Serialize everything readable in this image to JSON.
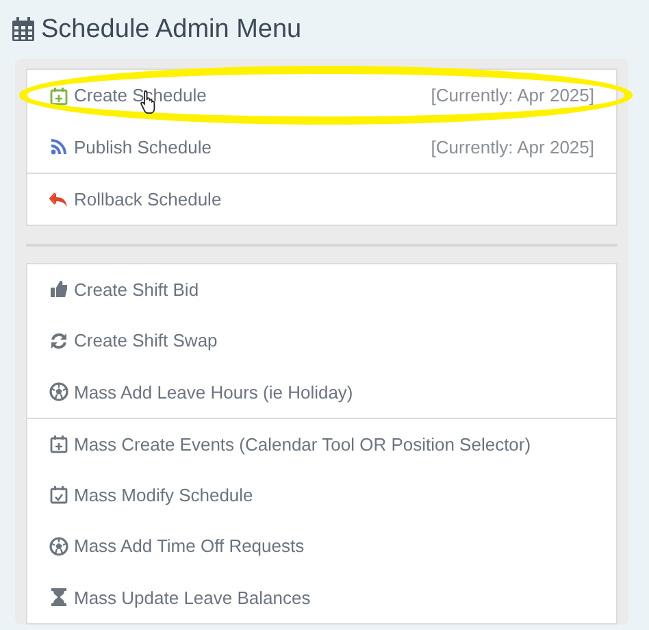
{
  "title": "Schedule Admin Menu",
  "groups": [
    {
      "items": [
        {
          "label": "Create Schedule",
          "note": "[Currently: Apr 2025]",
          "kind": "calendar-plus",
          "color": "#7cb342",
          "highlighted": true,
          "separated": false
        },
        {
          "label": "Publish Schedule",
          "note": "[Currently: Apr 2025]",
          "kind": "rss",
          "color": "#5577cc",
          "highlighted": false,
          "separated": false
        },
        {
          "label": "Rollback Schedule",
          "kind": "reply-all",
          "color": "#e0452b",
          "highlighted": false,
          "separated": true
        }
      ]
    },
    {
      "items": [
        {
          "label": "Create Shift Bid",
          "kind": "thumbs-up",
          "color": "#6c757d",
          "highlighted": false,
          "separated": false
        },
        {
          "label": "Create Shift Swap",
          "kind": "refresh",
          "color": "#6c757d",
          "highlighted": false,
          "separated": false
        },
        {
          "label": "Mass Add Leave Hours (ie Holiday)",
          "kind": "ball",
          "color": "#6c757d",
          "highlighted": false,
          "separated": false
        },
        {
          "label": "Mass Create Events (Calendar Tool OR Position Selector)",
          "kind": "calendar-plus",
          "color": "#6c757d",
          "highlighted": false,
          "separated": true
        },
        {
          "label": "Mass Modify Schedule",
          "kind": "calendar-check",
          "color": "#6c757d",
          "highlighted": false,
          "separated": false
        },
        {
          "label": "Mass Add Time Off Requests",
          "kind": "ball",
          "color": "#6c757d",
          "highlighted": false,
          "separated": false
        },
        {
          "label": "Mass Update Leave Balances",
          "kind": "hourglass",
          "color": "#6c757d",
          "highlighted": false,
          "separated": false
        }
      ]
    }
  ]
}
